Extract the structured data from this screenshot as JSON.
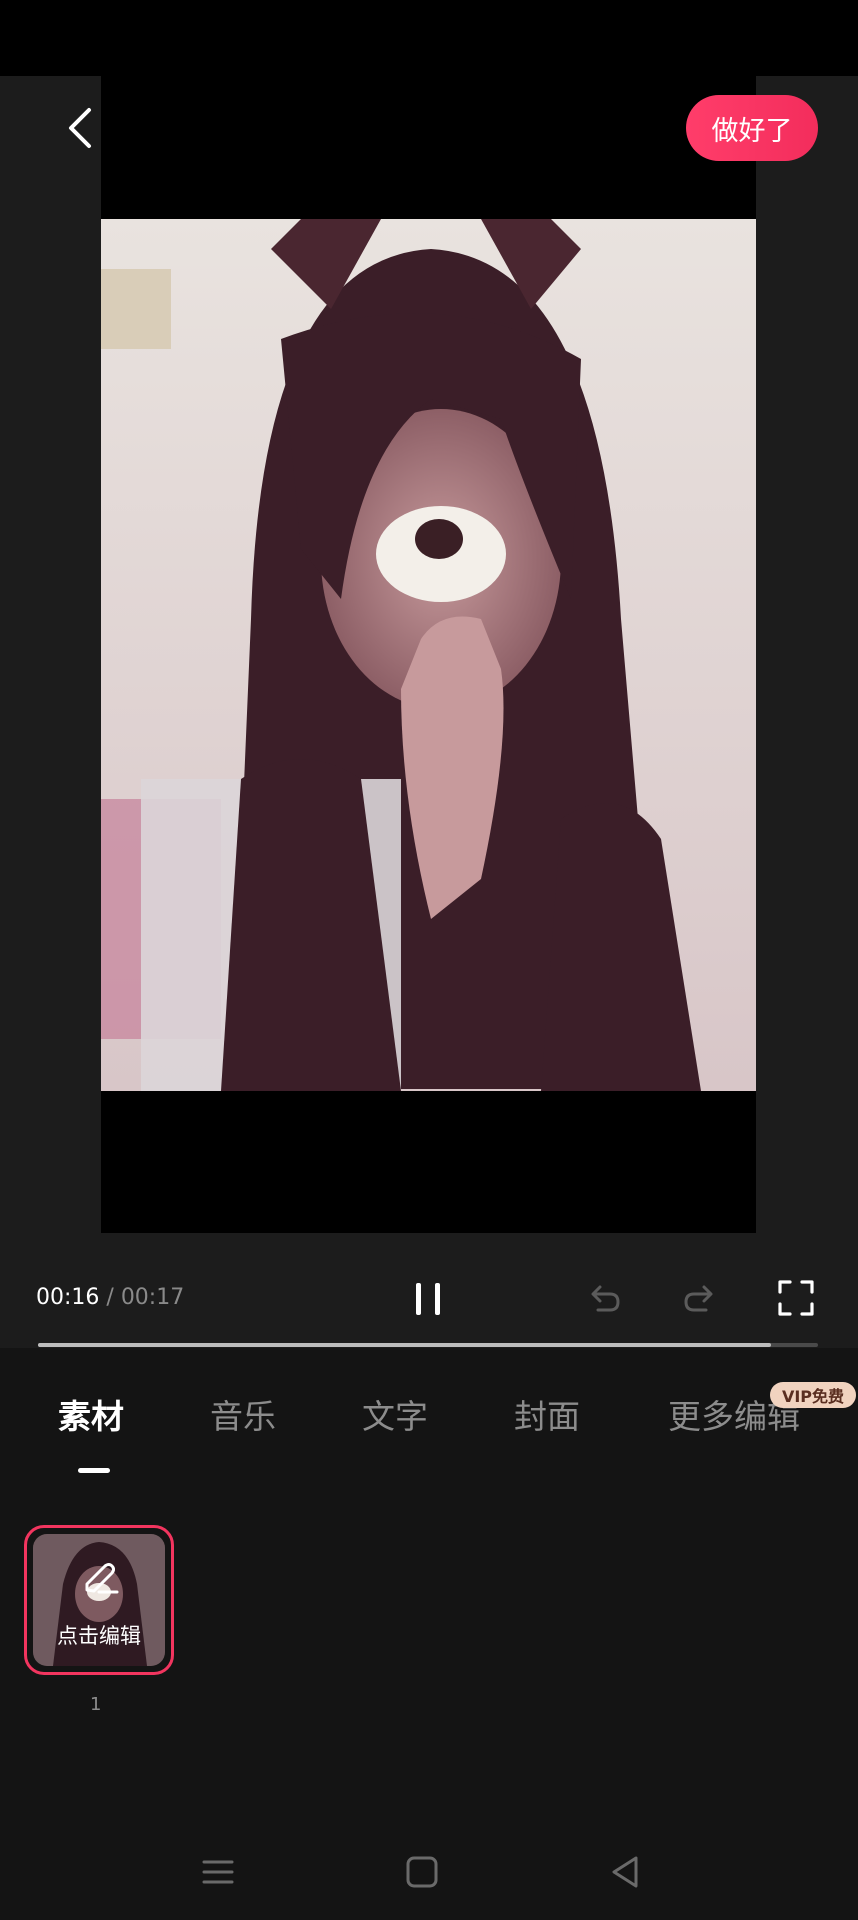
{
  "header": {
    "done_label": "做好了"
  },
  "player": {
    "current_time": "00:16",
    "separator": " / ",
    "total_time": "00:17",
    "progress": 0.94
  },
  "tabs": [
    {
      "label": "素材",
      "active": true
    },
    {
      "label": "音乐",
      "active": false
    },
    {
      "label": "文字",
      "active": false
    },
    {
      "label": "封面",
      "active": false
    },
    {
      "label": "更多编辑",
      "active": false
    }
  ],
  "vip_badge": "VIP免费",
  "clips": [
    {
      "edit_label": "点击编辑",
      "index": "1"
    }
  ],
  "colors": {
    "accent": "#f32d5c",
    "background": "#141414",
    "done_button": "#ff3d6a"
  },
  "icons": {
    "back": "chevron-left-icon",
    "pause": "pause-icon",
    "undo": "undo-icon",
    "redo": "redo-icon",
    "fullscreen": "fullscreen-icon",
    "edit": "pencil-icon",
    "menu": "menu-icon",
    "home": "home-icon",
    "back_nav": "back-triangle-icon"
  }
}
